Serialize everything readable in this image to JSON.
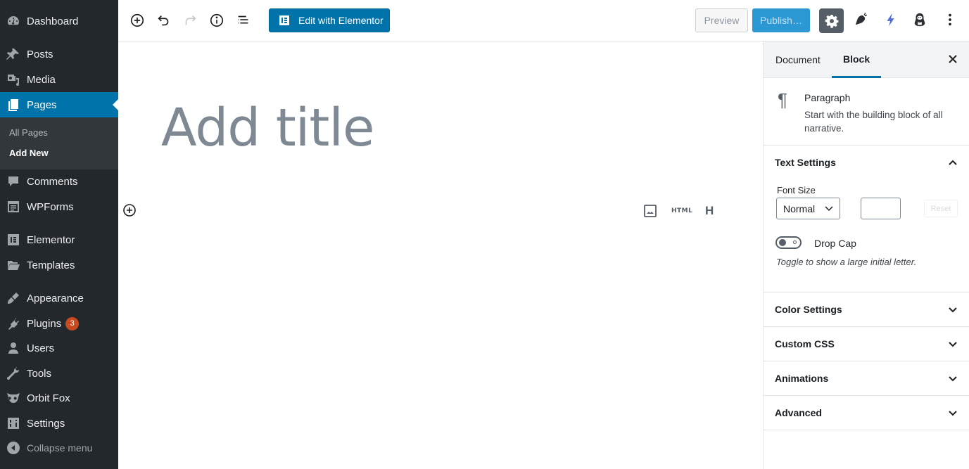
{
  "sidebar": {
    "items": [
      {
        "id": "dashboard",
        "label": "Dashboard",
        "icon": "dashboard-icon"
      },
      {
        "id": "posts",
        "label": "Posts",
        "icon": "pin-icon"
      },
      {
        "id": "media",
        "label": "Media",
        "icon": "media-icon"
      },
      {
        "id": "pages",
        "label": "Pages",
        "icon": "pages-icon",
        "active": true
      },
      {
        "id": "comments",
        "label": "Comments",
        "icon": "comment-icon"
      },
      {
        "id": "wpforms",
        "label": "WPForms",
        "icon": "form-icon"
      },
      {
        "id": "elementor",
        "label": "Elementor",
        "icon": "elementor-icon"
      },
      {
        "id": "templates",
        "label": "Templates",
        "icon": "folder-icon"
      },
      {
        "id": "appearance",
        "label": "Appearance",
        "icon": "brush-icon"
      },
      {
        "id": "plugins",
        "label": "Plugins",
        "icon": "plug-icon",
        "badge": "3"
      },
      {
        "id": "users",
        "label": "Users",
        "icon": "user-icon"
      },
      {
        "id": "tools",
        "label": "Tools",
        "icon": "wrench-icon"
      },
      {
        "id": "orbitfox",
        "label": "Orbit Fox",
        "icon": "fox-icon"
      },
      {
        "id": "settings",
        "label": "Settings",
        "icon": "sliders-icon"
      }
    ],
    "submenu": [
      {
        "label": "All Pages"
      },
      {
        "label": "Add New",
        "current": true
      }
    ],
    "collapse_label": "Collapse menu"
  },
  "toolbar": {
    "elementor_label": "Edit with Elementor",
    "preview_label": "Preview",
    "publish_label": "Publish…",
    "icons": [
      "add-block-icon",
      "undo-icon",
      "redo-icon",
      "info-icon",
      "block-navigation-icon",
      "gear-icon",
      "carrot-icon",
      "lightning-icon",
      "penguin-icon",
      "more-vertical-icon"
    ]
  },
  "editor": {
    "title_placeholder": "Add title",
    "block_tools": {
      "html_label": "HTML",
      "heading_label": "H"
    }
  },
  "panel": {
    "tabs": [
      {
        "label": "Document"
      },
      {
        "label": "Block",
        "active": true
      }
    ],
    "block": {
      "name": "Paragraph",
      "description": "Start with the building block of all narrative."
    },
    "text_settings": {
      "title": "Text Settings",
      "font_size_label": "Font Size",
      "font_size_value": "Normal",
      "custom_size_value": "",
      "reset_label": "Reset",
      "drop_cap_label": "Drop Cap",
      "drop_cap_enabled": false,
      "drop_cap_help": "Toggle to show a large initial letter."
    },
    "sections": [
      {
        "title": "Color Settings"
      },
      {
        "title": "Custom CSS"
      },
      {
        "title": "Animations"
      },
      {
        "title": "Advanced"
      }
    ]
  },
  "colors": {
    "accent": "#0073aa",
    "sidebar_bg": "#23282d",
    "submenu_bg": "#32373c",
    "badge": "#ca4a1f",
    "publish": "#2c98d3",
    "lightning": "#4f6bd8"
  }
}
